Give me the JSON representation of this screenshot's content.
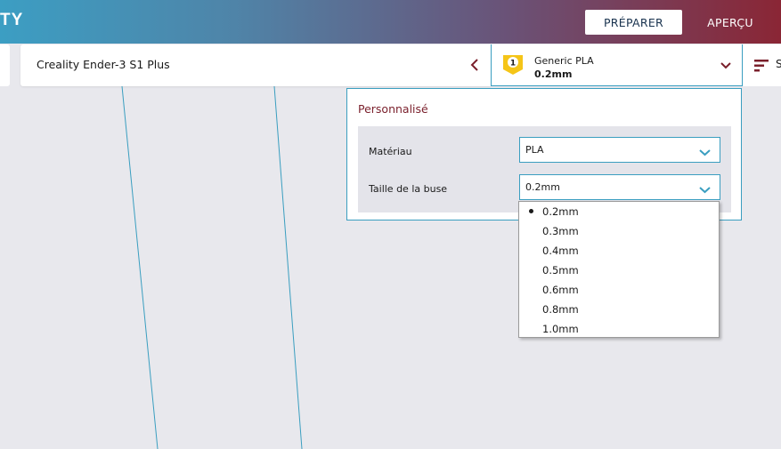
{
  "header": {
    "logo_fragment": "TY",
    "prepare_label": "PRÉPARER",
    "preview_label": "APERÇU"
  },
  "printer": {
    "name": "Creality Ender-3 S1 Plus"
  },
  "material_summary": {
    "extruder_number": "1",
    "material_name": "Generic PLA",
    "nozzle_size": "0.2mm"
  },
  "settings_stub": {
    "letter": "S"
  },
  "popup": {
    "title": "Personnalisé",
    "material_label": "Matériau",
    "material_value": "PLA",
    "nozzle_label": "Taille de la buse",
    "nozzle_value": "0.2mm"
  },
  "nozzle_options": [
    {
      "label": "0.2mm",
      "selected": true
    },
    {
      "label": "0.3mm",
      "selected": false
    },
    {
      "label": "0.4mm",
      "selected": false
    },
    {
      "label": "0.5mm",
      "selected": false
    },
    {
      "label": "0.6mm",
      "selected": false
    },
    {
      "label": "0.8mm",
      "selected": false
    },
    {
      "label": "1.0mm",
      "selected": false
    }
  ],
  "colors": {
    "accent_blue": "#3a9ec0",
    "title_red": "#7a1f2b",
    "extruder_yellow": "#f5c518"
  }
}
